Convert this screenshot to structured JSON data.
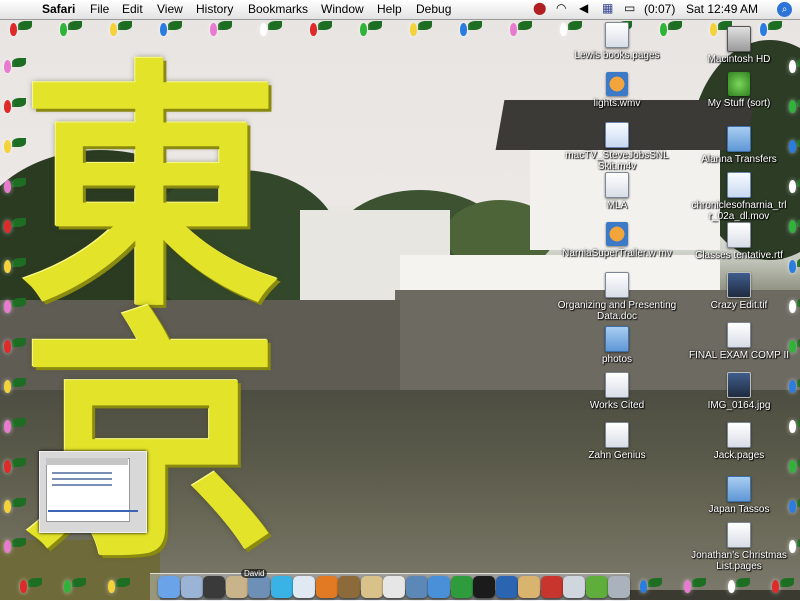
{
  "menubar": {
    "app_name": "Safari",
    "menus": [
      "File",
      "Edit",
      "View",
      "History",
      "Bookmarks",
      "Window",
      "Help",
      "Debug"
    ],
    "battery": "(0:07)",
    "clock": "Sat 12:49 AM",
    "status_icons": [
      "warning-icon",
      "wifi-icon",
      "volume-icon",
      "us-flag-icon",
      "battery-icon",
      "spotlight-icon"
    ]
  },
  "wallpaper": {
    "kanji_top": "東",
    "kanji_bottom": "京"
  },
  "desktop_icons": [
    {
      "label": "Lewis books.pages",
      "icon": "pages-doc-icon"
    },
    {
      "label": "Macintosh HD",
      "icon": "hard-drive-icon"
    },
    {
      "label": "lights.wmv",
      "icon": "wmv-movie-icon"
    },
    {
      "label": "My Stuff (sort)",
      "icon": "folder-green-icon"
    },
    {
      "label": "macTV_SteveJobsSNL Skit.m4v",
      "icon": "m4v-movie-icon"
    },
    {
      "label": "Alanna Transfers",
      "icon": "folder-icon"
    },
    {
      "label": "MLA",
      "icon": "document-icon"
    },
    {
      "label": "chroniclesofnarnia_trl r_02a_dl.mov",
      "icon": "quicktime-movie-icon"
    },
    {
      "label": "NarniaSuperTrailer.w mv",
      "icon": "wmv-movie-icon"
    },
    {
      "label": "Classes tentative.rtf",
      "icon": "rtf-doc-icon"
    },
    {
      "label": "Organizing and Presenting Data.doc",
      "icon": "word-doc-icon"
    },
    {
      "label": "Crazy Edit.tif",
      "icon": "tif-image-icon"
    },
    {
      "label": "photos",
      "icon": "folder-icon"
    },
    {
      "label": "FINAL EXAM COMP II",
      "icon": "document-icon"
    },
    {
      "label": "Works Cited",
      "icon": "pages-doc-icon"
    },
    {
      "label": "IMG_0164.jpg",
      "icon": "jpg-image-icon"
    },
    {
      "label": "Zahn Genius",
      "icon": "document-icon"
    },
    {
      "label": "Jack.pages",
      "icon": "pages-doc-icon"
    },
    {
      "label": "Japan Tassos",
      "icon": "folder-icon"
    },
    {
      "label": "Jonathan's Christmas List.pages",
      "icon": "pages-doc-icon"
    }
  ],
  "dock": {
    "tag": "David",
    "items": [
      "finder-icon",
      "mail-icon",
      "dashboard-icon",
      "address-book-icon",
      "photo-icon",
      "skype-icon",
      "itunes-icon",
      "firefox-icon",
      "pen-icon",
      "preview-icon",
      "ical-icon",
      "iphoto-icon",
      "safari-icon",
      "messenger-icon",
      "terminal-icon",
      "globe-icon",
      "home-icon",
      "hat-icon",
      "printer-icon",
      "network-icon",
      "trash-icon"
    ],
    "item_colors": [
      "#6aa3e8",
      "#9bb4d6",
      "#3a3a3a",
      "#c9b38a",
      "#6e8fb6",
      "#39b3e6",
      "#e0e8f2",
      "#e27a24",
      "#8c6a3a",
      "#d9c28a",
      "#e6e6e6",
      "#5c88b8",
      "#4a90d9",
      "#2e9c3c",
      "#1b1b1b",
      "#2b64b0",
      "#d9b46e",
      "#c8352c",
      "#cfd6de",
      "#5fae3c",
      "#aab3bd"
    ]
  }
}
